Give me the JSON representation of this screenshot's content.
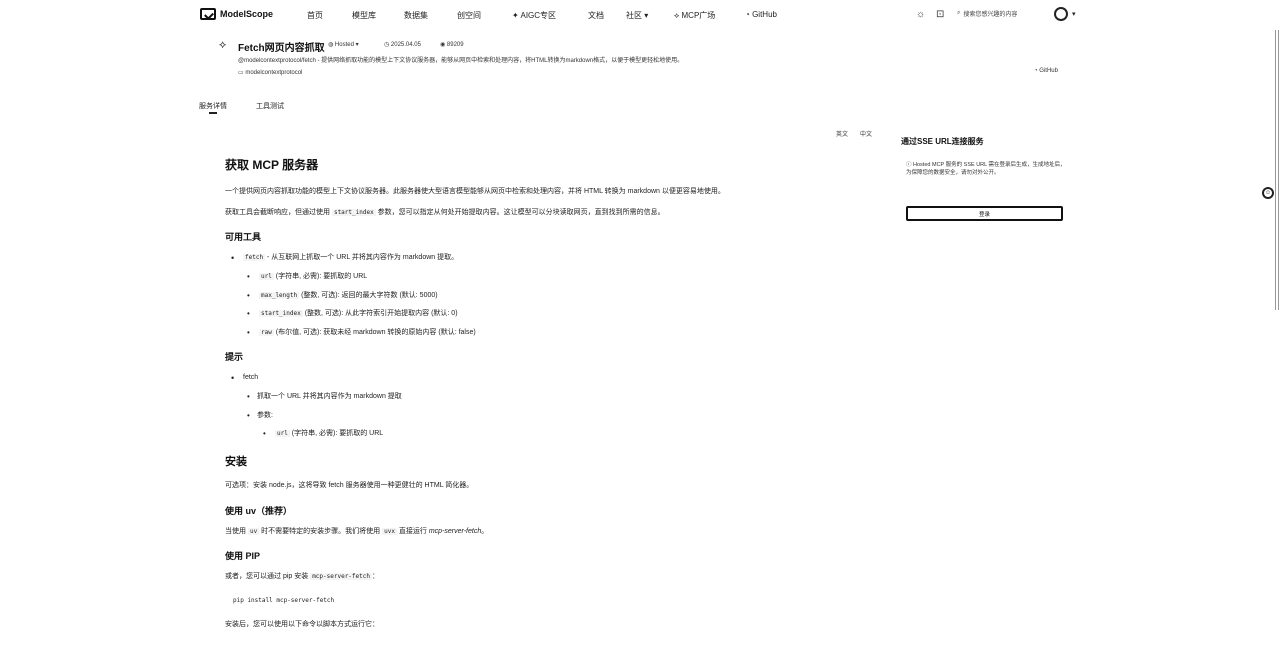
{
  "nav": {
    "logo": "ModelScope",
    "items": [
      "首页",
      "模型库",
      "数据集",
      "创空间",
      "AIGC专区",
      "文档",
      "社区",
      "MCP广场",
      "GitHub"
    ],
    "search_placeholder": "搜索您感兴趣的内容"
  },
  "header": {
    "title": "Fetch网页内容抓取",
    "hosted": "Hosted",
    "date": "2025.04.05",
    "views": "89209",
    "description": "@modelcontextprotocol/fetch - 提供网络抓取功能的模型上下文协议服务器，能够从网页中检索和处理内容，将HTML转换为markdown格式，以便于模型更轻松地使用。",
    "repo": "modelcontextprotocol",
    "github": "GitHub"
  },
  "tabs": [
    "服务详情",
    "工具测试"
  ],
  "lang": [
    "英文",
    "中文"
  ],
  "content": {
    "title": "获取 MCP 服务器",
    "intro": "一个提供网页内容抓取功能的模型上下文协议服务器。此服务器使大型语言模型能够从网页中检索和处理内容，并将 HTML 转换为 markdown 以便更容易地使用。",
    "p2_a": "获取工具会截断响应，但通过使用",
    "p2_code": "start_index",
    "p2_b": "参数，您可以指定从何处开始提取内容。这让模型可以分块读取网页，直到找到所需的信息。",
    "tools_heading": "可用工具",
    "tool_fetch_code": "fetch",
    "tool_fetch_desc": "- 从互联网上抓取一个 URL 并将其内容作为 markdown 提取。",
    "params": [
      {
        "code": "url",
        "desc": "(字符串, 必需): 要抓取的 URL"
      },
      {
        "code": "max_length",
        "desc": "(整数, 可选): 返回的最大字符数 (默认: 5000)"
      },
      {
        "code": "start_index",
        "desc": "(整数, 可选): 从此字符索引开始提取内容 (默认: 0)"
      },
      {
        "code": "raw",
        "desc": "(布尔值, 可选): 获取未经 markdown 转换的原始内容 (默认: false)"
      }
    ],
    "tips_heading": "提示",
    "tips_fetch": "fetch",
    "tips_fetch_desc": "抓取一个 URL 并将其内容作为 markdown 提取",
    "tips_params_label": "参数:",
    "tips_param_code": "url",
    "tips_param_desc": "(字符串, 必需): 要抓取的 URL",
    "install_heading": "安装",
    "install_text": "可选项：安装 node.js，这将导致 fetch 服务器使用一种更健壮的 HTML 简化器。",
    "uv_heading": "使用 uv（推荐）",
    "uv_a": "当使用",
    "uv_code1": "uv",
    "uv_b": "时不需要特定的安装步骤。我们将使用",
    "uv_code2": "uvx",
    "uv_c": "直接运行",
    "uv_italic": "mcp-server-fetch",
    "uv_d": "。",
    "pip_heading": "使用 PIP",
    "pip_a": "或者，您可以通过 pip 安装",
    "pip_code": "mcp-server-fetch",
    "pip_b": "：",
    "pip_cmd": "pip install mcp-server-fetch",
    "after_install": "安装后，您可以使用以下命令以脚本方式运行它："
  },
  "panel": {
    "title": "通过SSE URL连接服务",
    "note": "Hosted MCP 服务的 SSE URL 需在登录后生成，生成地址后，为保障您的数据安全，请勿对外公开。",
    "button": "登录"
  }
}
